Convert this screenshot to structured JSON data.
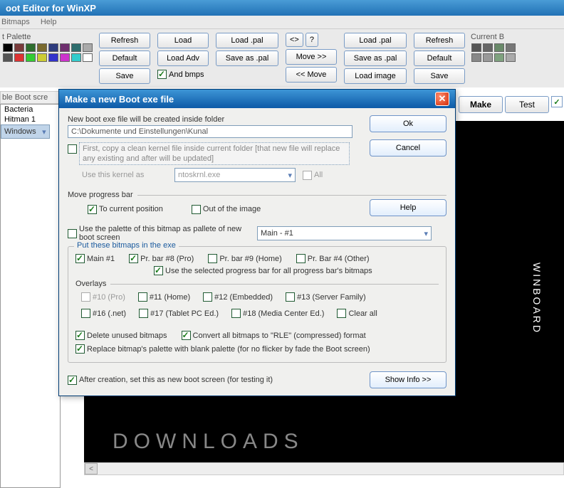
{
  "app": {
    "title": "oot Editor for WinXP"
  },
  "menu": {
    "item1": "Bitmaps",
    "item2": "Help"
  },
  "palette1": {
    "label": "t Palette"
  },
  "palette2": {
    "label": "Current B"
  },
  "buttons": {
    "refresh": "Refresh",
    "default": "Default",
    "save": "Save",
    "load": "Load",
    "loadadv": "Load Adv",
    "loadpal": "Load .pal",
    "saveaspal": "Save as .pal",
    "diamond": "<>",
    "q": "?",
    "movefwd": "Move >>",
    "moveback": "<< Move",
    "loadimage": "Load image",
    "andbmps": "And bmps",
    "make": "Make",
    "test": "Test"
  },
  "list": {
    "header": "ble Boot scre",
    "items": [
      "Bacteria",
      "Hitman 1",
      "Windows"
    ]
  },
  "dialog": {
    "title": "Make a new Boot exe file",
    "label_folder": "New boot exe file will be created inside folder",
    "folder": "C:\\Dokumente und Einstellungen\\Kunal",
    "note": "First, copy a clean kernel file inside current folder [that new file will replace any existing and after will be updated]",
    "use_kernel": "Use this kernel as",
    "kernel_file": "ntoskrnl.exe",
    "all": "All",
    "move_prog": "Move progress bar",
    "to_current": "To current position",
    "out_image": "Out of the image",
    "use_palette": "Use the palette of this bitmap as pallete of new boot screen",
    "bitmap_sel": "Main - #1",
    "group_title": "Put these bitmaps in the exe",
    "main1": "Main #1",
    "pr8": "Pr. bar #8 (Pro)",
    "pr9": "Pr. bar #9 (Home)",
    "pr4": "Pr. Bar #4 (Other)",
    "use_selected": "Use the selected progress bar for all progress bar's bitmaps",
    "overlays": "Overlays",
    "o10": "#10 (Pro)",
    "o11": "#11 (Home)",
    "o12": "#12 (Embedded)",
    "o13": "#13 (Server Family)",
    "o16": "#16 (.net)",
    "o17": "#17 (Tablet PC Ed.)",
    "o18": "#18 (Media Center Ed.)",
    "clearall": "Clear all",
    "del_unused": "Delete unused bitmaps",
    "convert_rle": "Convert all bitmaps to \"RLE\" (compressed) format",
    "replace_pal": "Replace bitmap's palette with blank palette (for no flicker by fade the Boot screen)",
    "after_creation": "After creation, set this as new boot screen (for testing it)",
    "ok": "Ok",
    "cancel": "Cancel",
    "help": "Help",
    "showinfo": "Show Info >>"
  },
  "preview": {
    "brand": "WINBOARD",
    "dl": "DOWNLOADS"
  }
}
